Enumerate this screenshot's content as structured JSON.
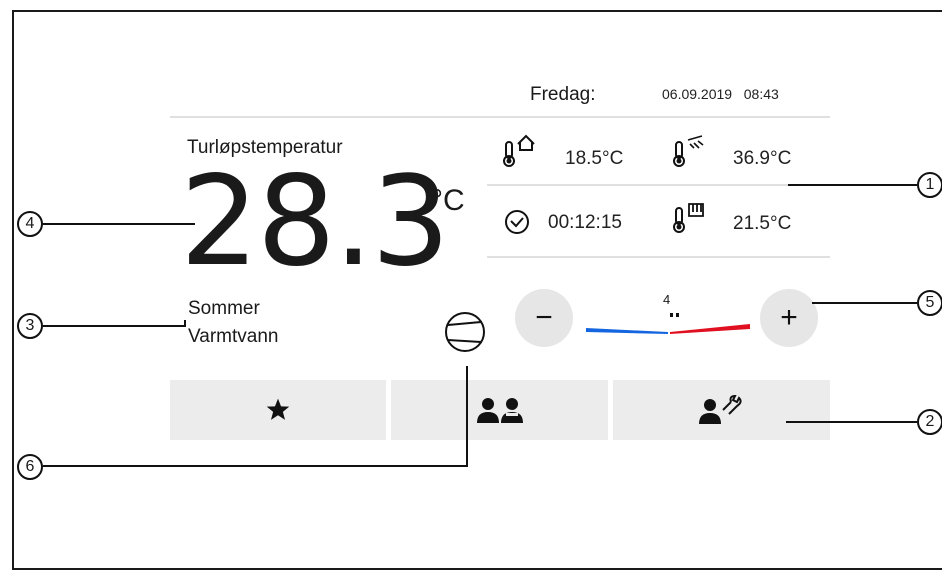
{
  "header": {
    "day": "Fredag:",
    "date": "06.09.2019",
    "time": "08:43"
  },
  "sensors": [
    {
      "icon": "outdoor-thermometer-icon",
      "value": "18.5°C"
    },
    {
      "icon": "hot-water-thermometer-icon",
      "value": "36.9°C"
    },
    {
      "icon": "clock-icon",
      "value": "00:12:15"
    },
    {
      "icon": "buffer-tank-thermometer-icon",
      "value": "21.5°C"
    }
  ],
  "flow": {
    "label": "Turløpstemperatur",
    "value": "28.3",
    "unit": "°C"
  },
  "modes": {
    "line1": "Sommer",
    "line2": "Varmtvann"
  },
  "adjust": {
    "minus": "−",
    "plus": "+",
    "level": "4"
  },
  "tiles": [
    {
      "icon": "star-icon"
    },
    {
      "icon": "users-icon"
    },
    {
      "icon": "service-user-icon"
    }
  ],
  "callouts": [
    "1",
    "2",
    "3",
    "4",
    "5",
    "6"
  ],
  "colors": {
    "cold": "#1565e0",
    "hot": "#e01020",
    "tile": "#ececec",
    "button": "#e6e6e6",
    "divider": "#e0e0e0"
  }
}
